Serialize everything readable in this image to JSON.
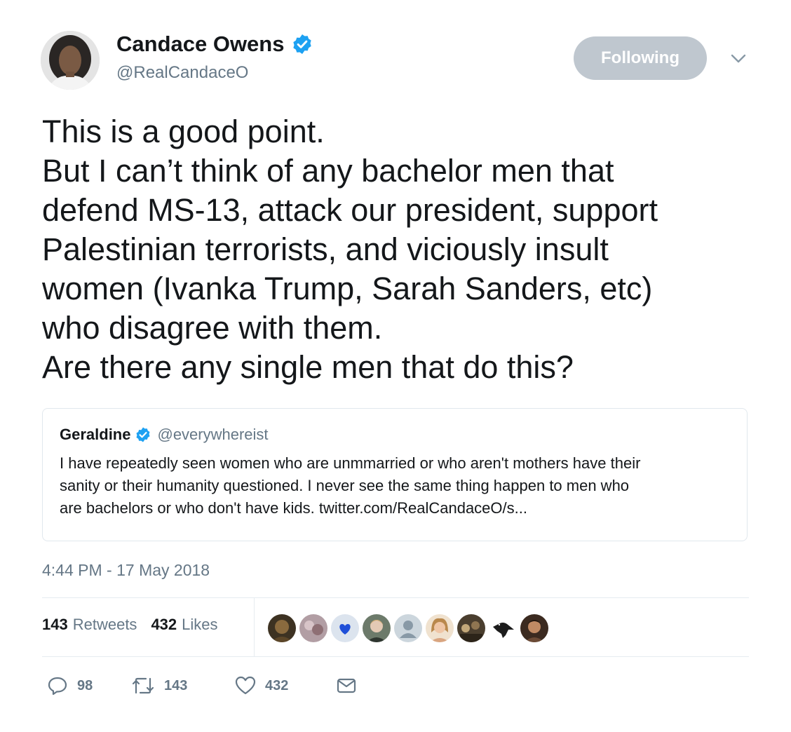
{
  "author": {
    "name": "Candace Owens",
    "handle": "@RealCandaceO",
    "verified": true
  },
  "follow_button": {
    "label": "Following"
  },
  "tweet": {
    "lines": [
      "This is a good point.",
      "But I can’t think of any bachelor men that",
      "defend MS-13, attack our president, support",
      "Palestinian terrorists, and viciously insult",
      "women (Ivanka Trump, Sarah Sanders, etc)",
      "who disagree with them.",
      "Are there any single men that do this?"
    ]
  },
  "quoted_tweet": {
    "name": "Geraldine",
    "handle": "@everywhereist",
    "verified": true,
    "lines": [
      "I have repeatedly seen women who are unmmarried or who aren't mothers have their",
      "sanity or their humanity questioned. I never see the same thing happen to men who",
      "are bachelors or who don't have kids. twitter.com/RealCandaceO/s..."
    ]
  },
  "timestamp": "4:44 PM - 17 May 2018",
  "stats": {
    "retweets_count": "143",
    "retweets_label": "Retweets",
    "likes_count": "432",
    "likes_label": "Likes"
  },
  "actions": {
    "replies": "98",
    "retweets": "143",
    "likes": "432"
  },
  "colors": {
    "verified": "#1da1f2",
    "follow_button_bg": "#bfc7cf",
    "secondary_text": "#657786",
    "primary_text": "#14171a",
    "border": "#e1e8ed"
  }
}
